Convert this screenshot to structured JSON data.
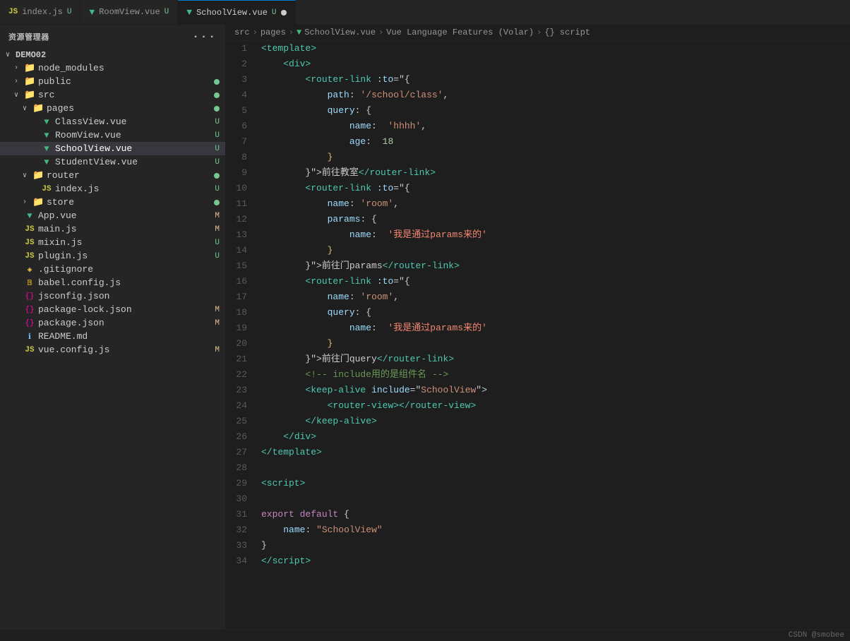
{
  "tabBar": {
    "tabs": [
      {
        "id": "index-js",
        "icon": "js",
        "label": "index.js",
        "badge": "U",
        "active": false
      },
      {
        "id": "roomview-vue",
        "icon": "vue",
        "label": "RoomView.vue",
        "badge": "U",
        "active": false
      },
      {
        "id": "schoolview-vue",
        "icon": "vue",
        "label": "SchoolView.vue",
        "badge": "U",
        "active": true,
        "dot": true
      }
    ]
  },
  "sidebar": {
    "title": "资源管理器",
    "root": "DEMO02",
    "items": [
      {
        "id": "node_modules",
        "type": "folder",
        "label": "node_modules",
        "indent": 12,
        "expanded": false,
        "badge": ""
      },
      {
        "id": "public",
        "type": "folder",
        "label": "public",
        "indent": 12,
        "expanded": false,
        "badge": "dot-green"
      },
      {
        "id": "src",
        "type": "folder",
        "label": "src",
        "indent": 12,
        "expanded": true,
        "badge": "dot-green"
      },
      {
        "id": "pages",
        "type": "folder",
        "label": "pages",
        "indent": 24,
        "expanded": true,
        "badge": "dot-green"
      },
      {
        "id": "classview",
        "type": "vue",
        "label": "ClassView.vue",
        "indent": 36,
        "badge": "U"
      },
      {
        "id": "roomview",
        "type": "vue",
        "label": "RoomView.vue",
        "indent": 36,
        "badge": "U"
      },
      {
        "id": "schoolview",
        "type": "vue",
        "label": "SchoolView.vue",
        "indent": 36,
        "badge": "U",
        "selected": true
      },
      {
        "id": "studentview",
        "type": "vue",
        "label": "StudentView.vue",
        "indent": 36,
        "badge": "U"
      },
      {
        "id": "router",
        "type": "folder",
        "label": "router",
        "indent": 24,
        "expanded": true,
        "badge": "dot-green"
      },
      {
        "id": "router-index",
        "type": "js",
        "label": "index.js",
        "indent": 36,
        "badge": "U"
      },
      {
        "id": "store",
        "type": "folder",
        "label": "store",
        "indent": 24,
        "expanded": false,
        "badge": "dot-green"
      },
      {
        "id": "app-vue",
        "type": "vue",
        "label": "App.vue",
        "indent": 12,
        "badge": "M"
      },
      {
        "id": "main-js",
        "type": "js",
        "label": "main.js",
        "indent": 12,
        "badge": "M"
      },
      {
        "id": "mixin-js",
        "type": "js",
        "label": "mixin.js",
        "indent": 12,
        "badge": "U"
      },
      {
        "id": "plugin-js",
        "type": "js",
        "label": "plugin.js",
        "indent": 12,
        "badge": "U"
      },
      {
        "id": "gitignore",
        "type": "git",
        "label": ".gitignore",
        "indent": 12,
        "badge": ""
      },
      {
        "id": "babel-config",
        "type": "babel",
        "label": "babel.config.js",
        "indent": 12,
        "badge": ""
      },
      {
        "id": "jsconfig",
        "type": "json",
        "label": "jsconfig.json",
        "indent": 12,
        "badge": ""
      },
      {
        "id": "package-lock",
        "type": "json",
        "label": "package-lock.json",
        "indent": 12,
        "badge": "M"
      },
      {
        "id": "package-json",
        "type": "json",
        "label": "package.json",
        "indent": 12,
        "badge": "M"
      },
      {
        "id": "readme",
        "type": "info",
        "label": "README.md",
        "indent": 12,
        "badge": ""
      },
      {
        "id": "vue-config",
        "type": "js",
        "label": "vue.config.js",
        "indent": 12,
        "badge": "M"
      }
    ]
  },
  "breadcrumb": {
    "parts": [
      "src",
      ">",
      "pages",
      ">",
      "SchoolView.vue",
      ">",
      "Vue Language Features (Volar)",
      ">",
      "{} script"
    ]
  },
  "footer": {
    "credit": "CSDN @smobee"
  }
}
